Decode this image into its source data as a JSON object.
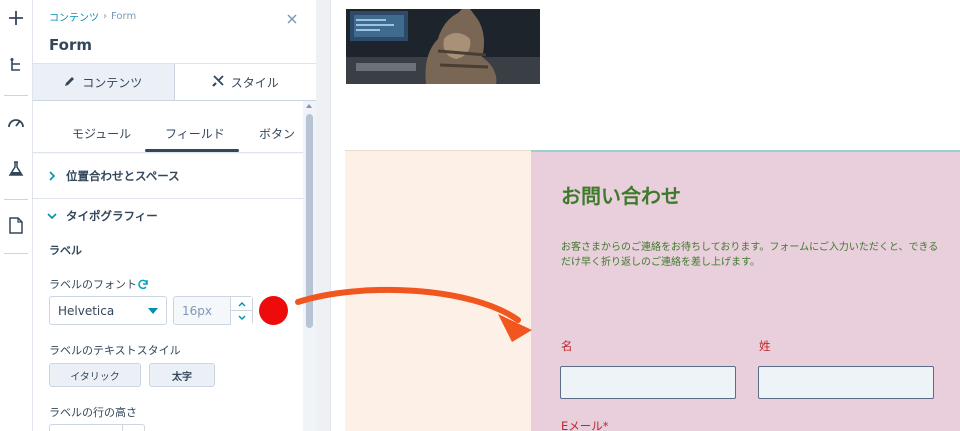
{
  "rail": {
    "icons": [
      "add-icon",
      "tree-structure-icon",
      "speedometer-icon",
      "flask-icon",
      "document-icon"
    ]
  },
  "panel": {
    "breadcrumb": {
      "parent": "コンテンツ",
      "separator": "›",
      "current": "Form"
    },
    "title": "Form",
    "tabs": [
      {
        "label": "コンテンツ",
        "icon": "pencil-icon"
      },
      {
        "label": "スタイル",
        "icon": "paintbrush-icon"
      }
    ],
    "subtabs": [
      "モジュール",
      "フィールド",
      "ボタン"
    ],
    "sections": {
      "alignment": "位置合わせとスペース",
      "typography": "タイポグラフィー"
    },
    "label_group": {
      "heading": "ラベル",
      "font_label": "ラベルのフォント",
      "font_value": "Helvetica",
      "size_value": "16px",
      "color": "#ee0b0b",
      "text_style_label": "ラベルのテキストスタイル",
      "italic_button": "イタリック",
      "bold_button": "太字",
      "line_height_label": "ラベルの行の高さ"
    }
  },
  "preview": {
    "form_title": "お問い合わせ",
    "form_description": "お客さまからのご連絡をお待ちしております。フォームにご入力いただくと、できるだけ早く折り返しのご連絡を差し上げます。",
    "fields": {
      "first_name": "名",
      "last_name": "姓",
      "email": "Eメール*"
    },
    "colors": {
      "title": "#3e7a2c",
      "label": "#c0262c",
      "panel_bg": "#e8cfdb",
      "arrow": "#f0561d"
    }
  }
}
